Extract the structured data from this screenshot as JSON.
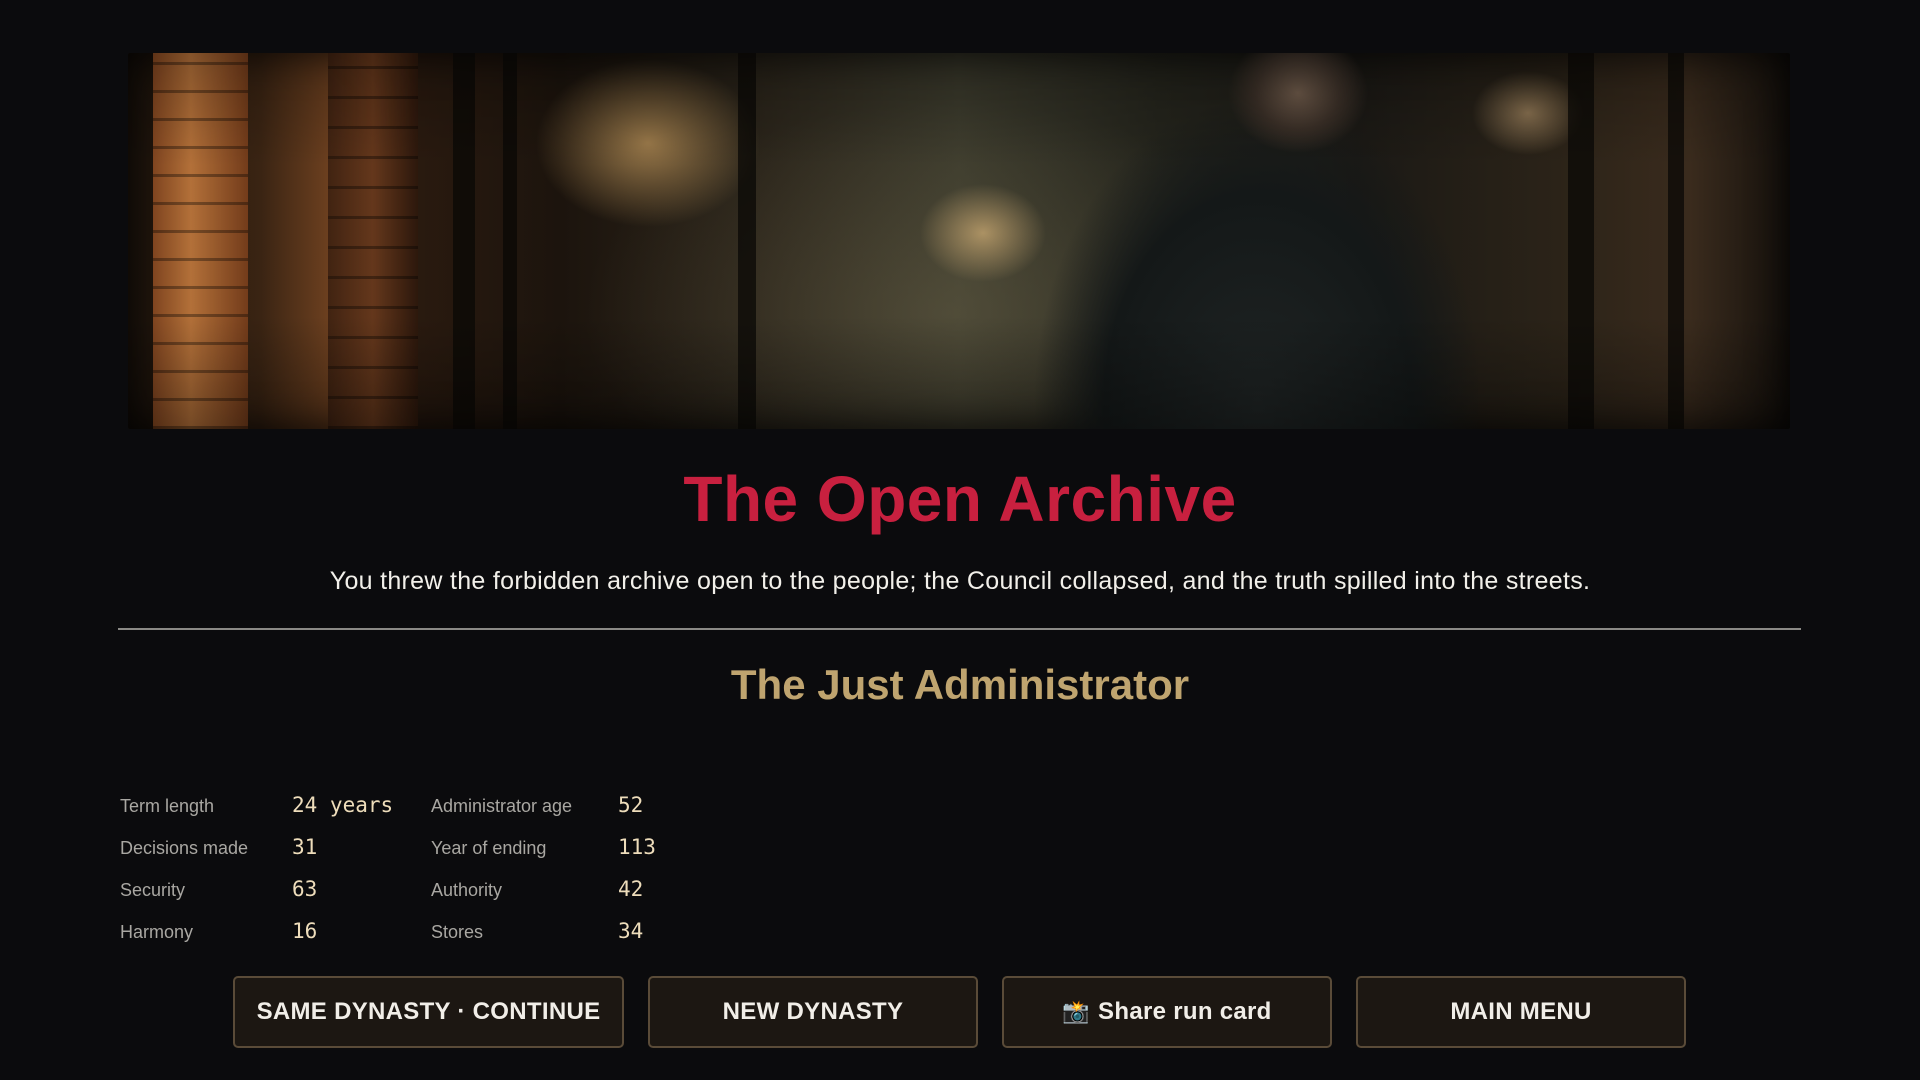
{
  "ending": {
    "title": "The Open Archive",
    "description": "You threw the forbidden archive open to the people; the Council collapsed, and the truth spilled into the streets.",
    "rank": "The Just Administrator"
  },
  "stats": {
    "term_length_label": "Term length",
    "term_length_value": "24 years",
    "administrator_age_label": "Administrator age",
    "administrator_age_value": "52",
    "decisions_made_label": "Decisions made",
    "decisions_made_value": "31",
    "year_of_ending_label": "Year of ending",
    "year_of_ending_value": "113",
    "security_label": "Security",
    "security_value": "63",
    "authority_label": "Authority",
    "authority_value": "42",
    "harmony_label": "Harmony",
    "harmony_value": "16",
    "stores_label": "Stores",
    "stores_value": "34"
  },
  "buttons": {
    "continue_label": "SAME DYNASTY · CONTINUE",
    "new_dynasty_label": "NEW DYNASTY",
    "share_icon": "camera-icon",
    "share_label": "Share run card",
    "main_menu_label": "MAIN MENU"
  },
  "colors": {
    "title": "#c8203f",
    "rank": "#bfa46f",
    "background": "#0b0b0d",
    "button_border": "#5a4b38"
  }
}
